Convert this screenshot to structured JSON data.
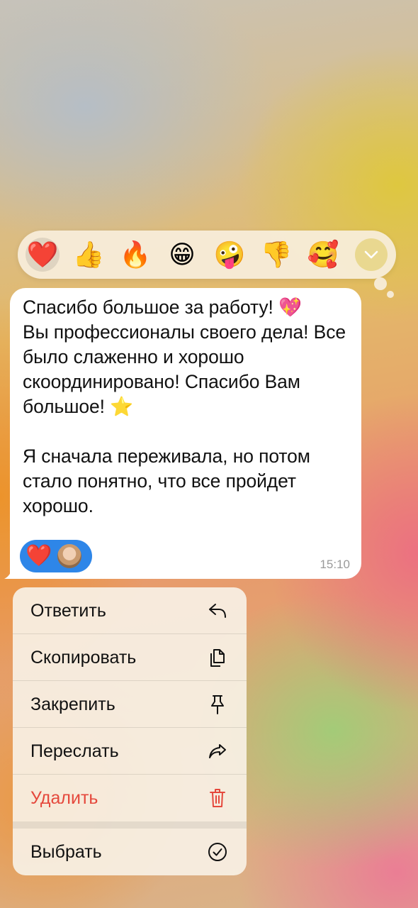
{
  "reaction_bar": {
    "emojis": [
      "❤️",
      "👍",
      "🔥",
      "😁",
      "🤪",
      "👎",
      "🥰"
    ],
    "selected": "❤️"
  },
  "message": {
    "text": "Спасибо большое за работу! 💖\nВы профессионалы своего дела! Все было слаженно и хорошо скоординировано! Спасибо Вам большое! ⭐️\n\nЯ сначала переживала, но потом стало понятно, что все пройдет хорошо.",
    "reaction": "❤️",
    "time": "15:10"
  },
  "menu": {
    "reply": "Ответить",
    "copy": "Скопировать",
    "pin": "Закрепить",
    "forward": "Переслать",
    "delete": "Удалить",
    "select": "Выбрать"
  },
  "colors": {
    "danger": "#e5483c",
    "reaction_chip": "#2e86e8",
    "expand_button": "#e9d890"
  }
}
